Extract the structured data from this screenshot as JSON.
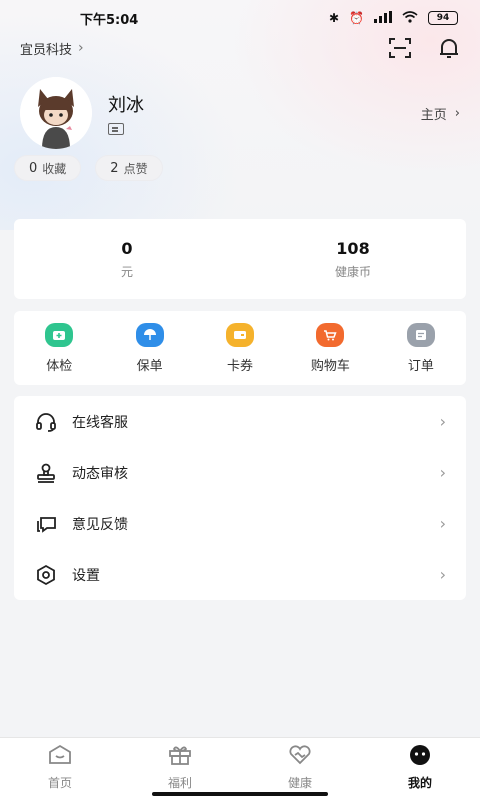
{
  "status_bar": {
    "time": "下午5:04",
    "battery": "94"
  },
  "header": {
    "org_name": "宜员科技"
  },
  "profile": {
    "name": "刘冰",
    "homepage_label": "主页"
  },
  "stats": [
    {
      "count": "0",
      "label": "收藏"
    },
    {
      "count": "2",
      "label": "点赞"
    }
  ],
  "wallet": [
    {
      "value": "0",
      "label": "元"
    },
    {
      "value": "108",
      "label": "健康币"
    }
  ],
  "shortcuts": [
    {
      "label": "体检",
      "icon": "medical-kit-icon",
      "color": "#2fc58f"
    },
    {
      "label": "保单",
      "icon": "umbrella-icon",
      "color": "#2f8ee8"
    },
    {
      "label": "卡券",
      "icon": "wallet-card-icon",
      "color": "#f5b22c"
    },
    {
      "label": "购物车",
      "icon": "cart-icon",
      "color": "#f26a2e"
    },
    {
      "label": "订单",
      "icon": "order-icon",
      "color": "#9aa1ab"
    }
  ],
  "menu": [
    {
      "label": "在线客服",
      "icon": "headset-icon"
    },
    {
      "label": "动态审核",
      "icon": "stamp-icon"
    },
    {
      "label": "意见反馈",
      "icon": "feedback-icon"
    },
    {
      "label": "设置",
      "icon": "settings-icon"
    }
  ],
  "tabs": [
    {
      "label": "首页",
      "icon": "home-icon",
      "active": false
    },
    {
      "label": "福利",
      "icon": "gift-icon",
      "active": false
    },
    {
      "label": "健康",
      "icon": "heart-icon",
      "active": false
    },
    {
      "label": "我的",
      "icon": "profile-face-icon",
      "active": true
    }
  ]
}
